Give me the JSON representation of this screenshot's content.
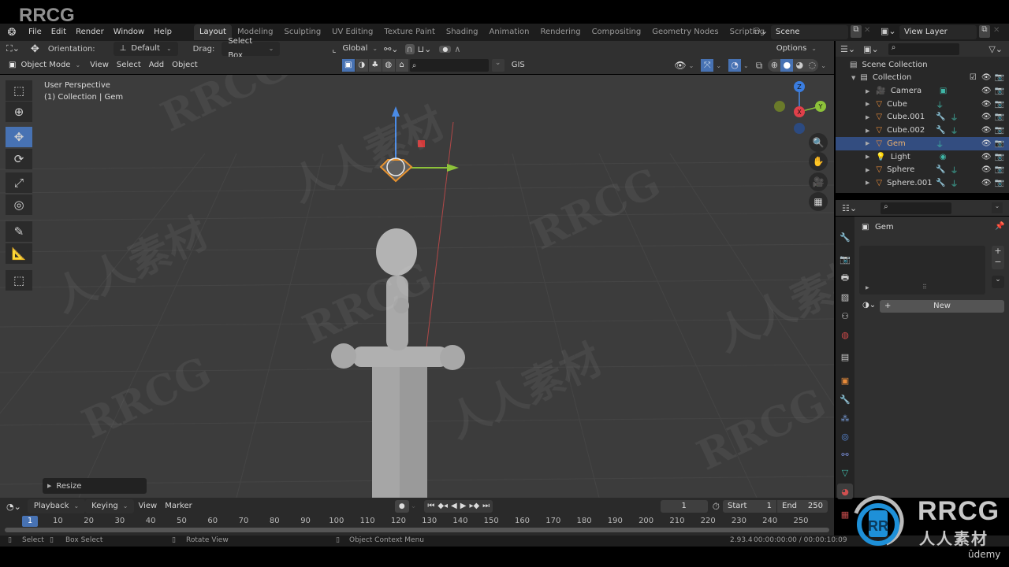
{
  "watermark": {
    "brand": "RRCG",
    "cn": "人人素材",
    "udemy": "ûdemy"
  },
  "menubar": {
    "items": [
      "File",
      "Edit",
      "Render",
      "Window",
      "Help"
    ],
    "workspaces": [
      "Layout",
      "Modeling",
      "Sculpting",
      "UV Editing",
      "Texture Paint",
      "Shading",
      "Animation",
      "Rendering",
      "Compositing",
      "Geometry Nodes",
      "Scripting"
    ],
    "active_workspace": "Layout",
    "add_tab": "+",
    "scene": "Scene",
    "view_layer": "View Layer"
  },
  "tool_header": {
    "orientation_label": "Orientation:",
    "orientation_value": "Default",
    "drag_label": "Drag:",
    "drag_value": "Select Box",
    "transform_orientation": "Global",
    "options_label": "Options"
  },
  "view_header": {
    "mode": "Object Mode",
    "menus": [
      "View",
      "Select",
      "Add",
      "Object"
    ],
    "search_placeholder": "",
    "gis_label": "GIS"
  },
  "viewport": {
    "perspective": "User Perspective",
    "context": "(1) Collection | Gem",
    "gizmo_axes": [
      "Z",
      "X",
      "Y"
    ],
    "last_operator": "Resize"
  },
  "tools": [
    "select-box",
    "cursor",
    "move",
    "rotate",
    "scale",
    "transform",
    "annotate",
    "measure",
    "add-cube"
  ],
  "active_tool": "move",
  "outliner": {
    "search_placeholder": "",
    "scene_collection": "Scene Collection",
    "collection": "Collection",
    "items": [
      {
        "name": "Camera",
        "type": "camera",
        "extras": [
          "camera-data"
        ]
      },
      {
        "name": "Cube",
        "type": "mesh",
        "extras": [
          "mesh-data"
        ]
      },
      {
        "name": "Cube.001",
        "type": "mesh",
        "extras": [
          "modifier",
          "mesh-data"
        ]
      },
      {
        "name": "Cube.002",
        "type": "mesh",
        "extras": [
          "modifier",
          "mesh-data"
        ]
      },
      {
        "name": "Gem",
        "type": "mesh",
        "extras": [
          "mesh-data"
        ],
        "selected": true
      },
      {
        "name": "Light",
        "type": "light",
        "extras": [
          "light-data"
        ]
      },
      {
        "name": "Sphere",
        "type": "mesh",
        "extras": [
          "modifier",
          "mesh-data"
        ]
      },
      {
        "name": "Sphere.001",
        "type": "mesh",
        "extras": [
          "modifier",
          "mesh-data"
        ]
      }
    ]
  },
  "properties": {
    "object_name": "Gem",
    "new_button": "New",
    "tabs": [
      "tool",
      "render",
      "output",
      "view-layer",
      "scene",
      "world",
      "collection",
      "object",
      "modifiers",
      "particles",
      "physics",
      "constraints",
      "data",
      "material",
      "texture"
    ],
    "active_tab": "material"
  },
  "timeline": {
    "menus": [
      "Playback",
      "Keying",
      "View",
      "Marker"
    ],
    "current_frame": "1",
    "start_label": "Start",
    "start": "1",
    "end_label": "End",
    "end": "250",
    "ticks": [
      "10",
      "20",
      "30",
      "40",
      "50",
      "60",
      "70",
      "80",
      "90",
      "100",
      "110",
      "120",
      "130",
      "140",
      "150",
      "160",
      "170",
      "180",
      "190",
      "200",
      "210",
      "220",
      "230",
      "240",
      "250"
    ],
    "playhead": "1"
  },
  "statusbar": {
    "select": "Select",
    "box_select": "Box Select",
    "rotate_view": "Rotate View",
    "context_menu": "Object Context Menu",
    "version": "2.93.4",
    "time": "00:00:00:00 / 00:00:10:09"
  },
  "colors": {
    "accent": "#4772b3",
    "selected_row": "#334d80",
    "object_orange": "#e88b3a",
    "data_green": "#3fb5a5",
    "modifier_blue": "#7a9be0"
  }
}
